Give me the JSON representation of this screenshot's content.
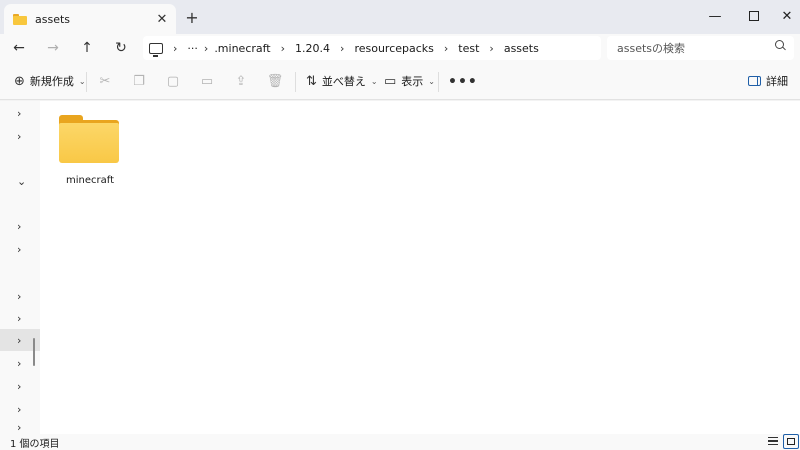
{
  "window": {
    "tab_title": "assets",
    "tab_close": "✕",
    "new_tab": "+",
    "minimize": "—",
    "close": "✕"
  },
  "nav": {
    "back": "←",
    "forward": "→",
    "up": "↑",
    "refresh": "↻"
  },
  "address": {
    "separator": "›",
    "ellipsis": "···",
    "crumbs": [
      ".minecraft",
      "1.20.4",
      "resourcepacks",
      "test",
      "assets"
    ]
  },
  "search": {
    "placeholder": "assetsの検索"
  },
  "commandbar": {
    "new_label": "新規作成",
    "sort_label": "並べ替え",
    "view_label": "表示",
    "more": "•••",
    "details_label": "詳細",
    "chevron": "⌄"
  },
  "navpane": {
    "rows": [
      {
        "glyph": "›",
        "expanded": false
      },
      {
        "glyph": "›",
        "expanded": false
      },
      {
        "glyph": "⌄",
        "expanded": true
      },
      {
        "glyph": "›",
        "expanded": false
      },
      {
        "glyph": "›",
        "expanded": false
      },
      {
        "glyph": "›",
        "expanded": false
      },
      {
        "glyph": "›",
        "expanded": false
      },
      {
        "glyph": "›",
        "expanded": false,
        "selected": true
      },
      {
        "glyph": "›",
        "expanded": false
      },
      {
        "glyph": "›",
        "expanded": false
      },
      {
        "glyph": "›",
        "expanded": false
      },
      {
        "glyph": "›",
        "expanded": false
      }
    ]
  },
  "content": {
    "items": [
      {
        "name": "minecraft",
        "type": "folder"
      }
    ]
  },
  "statusbar": {
    "item_count": "1 個の項目"
  },
  "colors": {
    "accent": "#1f5fa8",
    "folder_tab": "#e9a51f",
    "folder_body": "#f9c846"
  }
}
